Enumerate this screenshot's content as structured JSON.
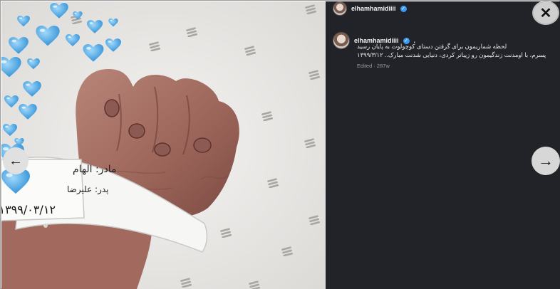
{
  "post": {
    "username": "elhamhamidiiii",
    "verified_icon": "verified-badge-icon",
    "more_label": "•••"
  },
  "comment": {
    "username": "elhamhamidiiii",
    "suffix": ".",
    "line1": "لحظه شماریمون برای گرفتن دستای کوچولوت به پایان رسید",
    "line2": "پسرم، با اومدنت زندگیمون رو زیباتر کردی، دنیایی شدنت مبارک.. ۱۳۹۹/۳/۱۲",
    "meta": "Edited · 287w"
  },
  "photo": {
    "band_line1": "مادر: الهام",
    "band_line2": "پدر: علیرضا",
    "band_date": "۱۳۹۹/۰۳/۱۲"
  },
  "controls": {
    "close_symbol": "✕",
    "next_symbol": "→",
    "prev_symbol": "←"
  },
  "colors": {
    "panel_bg": "#212328",
    "heart": "#4aa8e6",
    "verified": "#3b9bf5"
  }
}
